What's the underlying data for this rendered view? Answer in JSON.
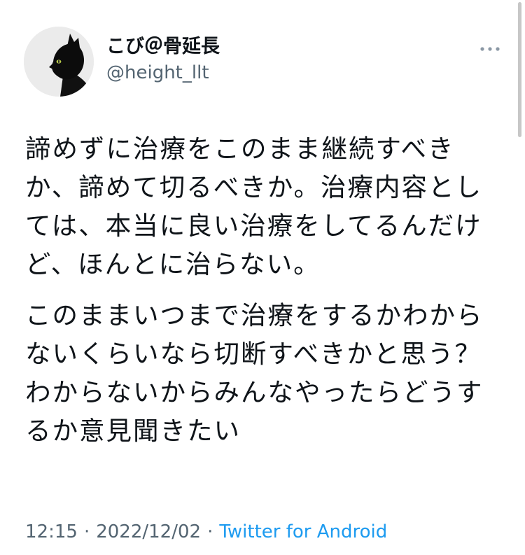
{
  "tweet": {
    "author": {
      "display_name": "こび＠骨延長",
      "handle": "@height_llt",
      "avatar": "black-cat-avatar"
    },
    "paragraphs": [
      "諦めずに治療をこのまま継続すべきか、諦めて切るべきか。治療内容としては、本当に良い治療をしてるんだけど、ほんとに治らない。",
      "このままいつまで治療をするかわからないくらいなら切断すべきかと思う？わからないからみんなやったらどうするか意見聞きたい"
    ],
    "time": "12:15",
    "separator": "·",
    "date": "2022/12/02",
    "source": "Twitter for Android"
  },
  "icons": {
    "more": "more-horizontal-icon"
  },
  "colors": {
    "text": "#0f1419",
    "secondary": "#536471",
    "link": "#1d9bf0"
  }
}
